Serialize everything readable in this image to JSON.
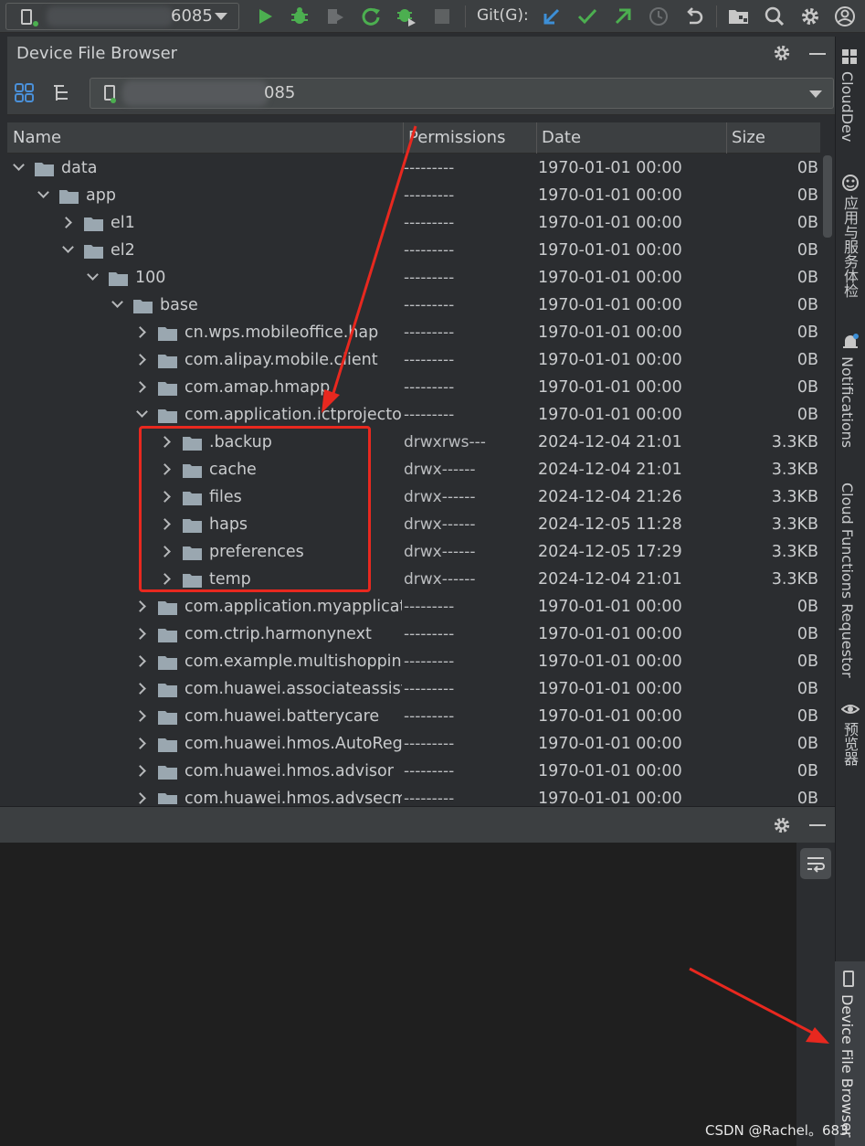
{
  "toolbar": {
    "device_suffix": "6085",
    "git_label": "Git(G):",
    "icons": [
      "run-icon",
      "debug-icon",
      "profile-icon",
      "apply-changes-icon",
      "attach-debugger-icon",
      "stop-icon",
      "git-update-icon",
      "git-commit-icon",
      "git-push-icon",
      "history-icon",
      "rollback-icon",
      "project-structure-icon",
      "search-icon",
      "settings-icon",
      "account-icon"
    ]
  },
  "panel": {
    "title": "Device File Browser",
    "path_suffix": "085"
  },
  "table": {
    "columns": [
      "Name",
      "Permissions",
      "Date",
      "Size"
    ],
    "rows": [
      {
        "indent": 0,
        "expanded": true,
        "name": "data",
        "perm": "---------",
        "date": "1970-01-01 00:00",
        "size": "0B"
      },
      {
        "indent": 1,
        "expanded": true,
        "name": "app",
        "perm": "---------",
        "date": "1970-01-01 00:00",
        "size": "0B"
      },
      {
        "indent": 2,
        "expanded": false,
        "name": "el1",
        "perm": "---------",
        "date": "1970-01-01 00:00",
        "size": "0B"
      },
      {
        "indent": 2,
        "expanded": true,
        "name": "el2",
        "perm": "---------",
        "date": "1970-01-01 00:00",
        "size": "0B"
      },
      {
        "indent": 3,
        "expanded": true,
        "name": "100",
        "perm": "---------",
        "date": "1970-01-01 00:00",
        "size": "0B"
      },
      {
        "indent": 4,
        "expanded": true,
        "name": "base",
        "perm": "---------",
        "date": "1970-01-01 00:00",
        "size": "0B"
      },
      {
        "indent": 5,
        "expanded": false,
        "name": "cn.wps.mobileoffice.hap",
        "perm": "---------",
        "date": "1970-01-01 00:00",
        "size": "0B"
      },
      {
        "indent": 5,
        "expanded": false,
        "name": "com.alipay.mobile.client",
        "perm": "---------",
        "date": "1970-01-01 00:00",
        "size": "0B"
      },
      {
        "indent": 5,
        "expanded": false,
        "name": "com.amap.hmapp",
        "perm": "---------",
        "date": "1970-01-01 00:00",
        "size": "0B"
      },
      {
        "indent": 5,
        "expanded": true,
        "name": "com.application.ictprojector",
        "perm": "---------",
        "date": "1970-01-01 00:00",
        "size": "0B"
      },
      {
        "indent": 6,
        "expanded": false,
        "name": ".backup",
        "perm": "drwxrws---",
        "date": "2024-12-04 21:01",
        "size": "3.3KB"
      },
      {
        "indent": 6,
        "expanded": false,
        "name": "cache",
        "perm": "drwx------",
        "date": "2024-12-04 21:01",
        "size": "3.3KB"
      },
      {
        "indent": 6,
        "expanded": false,
        "name": "files",
        "perm": "drwx------",
        "date": "2024-12-04 21:26",
        "size": "3.3KB"
      },
      {
        "indent": 6,
        "expanded": false,
        "name": "haps",
        "perm": "drwx------",
        "date": "2024-12-05 11:28",
        "size": "3.3KB"
      },
      {
        "indent": 6,
        "expanded": false,
        "name": "preferences",
        "perm": "drwx------",
        "date": "2024-12-05 17:29",
        "size": "3.3KB"
      },
      {
        "indent": 6,
        "expanded": false,
        "name": "temp",
        "perm": "drwx------",
        "date": "2024-12-04 21:01",
        "size": "3.3KB"
      },
      {
        "indent": 5,
        "expanded": false,
        "name": "com.application.myapplication",
        "perm": "---------",
        "date": "1970-01-01 00:00",
        "size": "0B"
      },
      {
        "indent": 5,
        "expanded": false,
        "name": "com.ctrip.harmonynext",
        "perm": "---------",
        "date": "1970-01-01 00:00",
        "size": "0B"
      },
      {
        "indent": 5,
        "expanded": false,
        "name": "com.example.multishopping",
        "perm": "---------",
        "date": "1970-01-01 00:00",
        "size": "0B"
      },
      {
        "indent": 5,
        "expanded": false,
        "name": "com.huawei.associateassistant",
        "perm": "---------",
        "date": "1970-01-01 00:00",
        "size": "0B"
      },
      {
        "indent": 5,
        "expanded": false,
        "name": "com.huawei.batterycare",
        "perm": "---------",
        "date": "1970-01-01 00:00",
        "size": "0B"
      },
      {
        "indent": 5,
        "expanded": false,
        "name": "com.huawei.hmos.AutoRegSvc",
        "perm": "---------",
        "date": "1970-01-01 00:00",
        "size": "0B"
      },
      {
        "indent": 5,
        "expanded": false,
        "name": "com.huawei.hmos.advisor",
        "perm": "---------",
        "date": "1970-01-01 00:00",
        "size": "0B"
      },
      {
        "indent": 5,
        "expanded": false,
        "name": "com.huawei.hmos.advsecmode",
        "perm": "---------",
        "date": "1970-01-01 00:00",
        "size": "0B"
      }
    ]
  },
  "right_strip": {
    "clouddev": "CloudDev",
    "app_services": "应用与服务体检",
    "notifications": "Notifications",
    "cloud_functions": "Cloud Functions Requestor",
    "previewer": "预览器",
    "device_file_browser": "Device File Browser"
  },
  "watermark": "CSDN @Rachel。683",
  "colors": {
    "accent_green": "#4caf50",
    "annotation_red": "#e8281f",
    "folder": "#9aa7b0"
  }
}
